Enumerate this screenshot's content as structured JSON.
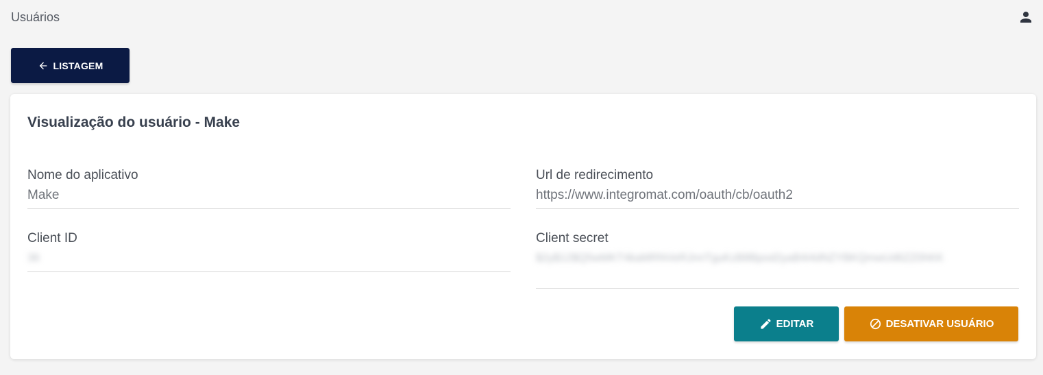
{
  "header": {
    "title": "Usuários",
    "user_icon": "person-icon"
  },
  "toolbar": {
    "back_label": "LISTAGEM",
    "back_icon": "arrow-left-icon"
  },
  "card": {
    "title": "Visualização do usuário - Make",
    "fields": [
      {
        "label": "Nome do aplicativo",
        "value": "Make"
      },
      {
        "label": "Url de redirecimento",
        "value": "https://www.integromat.com/oauth/cb/oauth2"
      },
      {
        "label": "Client ID",
        "value": "36"
      },
      {
        "label": "Client secret",
        "value": "$2y$12$Q5wMKT4kaMRNVeRJnnTguKzB8Bpod2yaB4i4dNZYBKQmwUd6ZZ0hKK"
      }
    ],
    "actions": {
      "edit_label": "EDITAR",
      "edit_icon": "pencil-icon",
      "deactivate_label": "DESATIVAR USUÁRIO",
      "deactivate_icon": "block-icon"
    }
  },
  "colors": {
    "primary": "#0b1a44",
    "edit": "#0b7f8c",
    "deactivate": "#d98307",
    "background": "#f4f4f4"
  }
}
